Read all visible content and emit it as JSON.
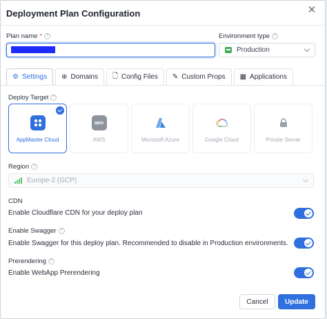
{
  "dialog": {
    "title": "Deployment Plan Configuration",
    "close_glyph": "✕"
  },
  "plan_name": {
    "label": "Plan name",
    "required_mark": "*",
    "value": ""
  },
  "environment": {
    "label": "Environment type",
    "value": "Production",
    "icon": "server-icon"
  },
  "tabs": [
    {
      "label": "Settings",
      "icon": "gear-icon",
      "glyph": "⚙",
      "active": true
    },
    {
      "label": "Domains",
      "icon": "globe-icon",
      "glyph": "⊕",
      "active": false
    },
    {
      "label": "Config Files",
      "icon": "file-icon",
      "glyph": "🗋",
      "active": false
    },
    {
      "label": "Custom Props",
      "icon": "wrench-icon",
      "glyph": "✎",
      "active": false
    },
    {
      "label": "Applications",
      "icon": "grid-icon",
      "glyph": "▦",
      "active": false
    }
  ],
  "deploy_target": {
    "label": "Deploy Target",
    "options": [
      {
        "label": "AppMaster Cloud",
        "selected": true
      },
      {
        "label": "AWS",
        "logo_text": "aws",
        "selected": false
      },
      {
        "label": "Microsoft Azure",
        "selected": false
      },
      {
        "label": "Google Cloud",
        "selected": false
      },
      {
        "label": "Private Server",
        "selected": false
      }
    ]
  },
  "region": {
    "label": "Region",
    "value": "Europe-2 (GCP)"
  },
  "cdn": {
    "label": "CDN",
    "description": "Enable Cloudflare CDN for your deploy plan",
    "enabled": true
  },
  "swagger": {
    "label": "Enable Swagger",
    "description": "Enable Swagger for this deploy plan. Recommended to disable in Production environments.",
    "enabled": true
  },
  "prerendering": {
    "label": "Prerendering",
    "description": "Enable WebApp Prerendering",
    "enabled": true
  },
  "actions": {
    "cancel": "Cancel",
    "update": "Update"
  },
  "colors": {
    "accent": "#2f6fde",
    "success": "#3fae5a",
    "redaction": "#1d2bff"
  }
}
